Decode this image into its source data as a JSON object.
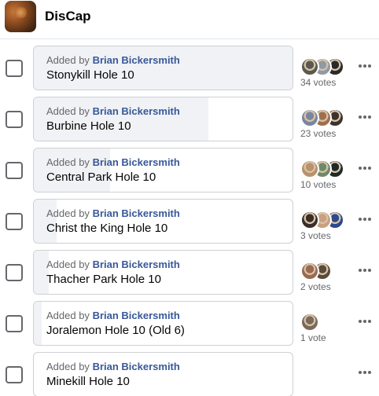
{
  "group": {
    "name": "DisCap"
  },
  "added_prefix": "Added by",
  "options": [
    {
      "author": "Brian Bickersmith",
      "name": "Stonykill Hole 10",
      "votes_label": "34 votes",
      "share": 1.0,
      "avatars": [
        "#5a5a4e",
        "#8f9aa3",
        "#2b2a28"
      ]
    },
    {
      "author": "Brian Bickersmith",
      "name": "Burbine Hole 10",
      "votes_label": "23 votes",
      "share": 0.676,
      "avatars": [
        "#7a86a0",
        "#a0704e",
        "#3b342e"
      ]
    },
    {
      "author": "Brian Bickersmith",
      "name": "Central Park Hole 10",
      "votes_label": "10 votes",
      "share": 0.294,
      "avatars": [
        "#b8926a",
        "#6d8a6a",
        "#1e2a26"
      ]
    },
    {
      "author": "Brian Bickersmith",
      "name": "Christ the King Hole 10",
      "votes_label": "3 votes",
      "share": 0.088,
      "avatars": [
        "#3a2e28",
        "#c9a080",
        "#2d4a8a"
      ]
    },
    {
      "author": "Brian Bickersmith",
      "name": "Thacher Park Hole 10",
      "votes_label": "2 votes",
      "share": 0.059,
      "avatars": [
        "#9a6a52",
        "#5a4a3a"
      ]
    },
    {
      "author": "Brian Bickersmith",
      "name": "Joralemon Hole 10 (Old 6)",
      "votes_label": "1 vote",
      "share": 0.029,
      "avatars": [
        "#7a6a5a"
      ]
    },
    {
      "author": "Brian Bickersmith",
      "name": "Minekill Hole 10",
      "votes_label": "",
      "share": 0.0,
      "avatars": []
    }
  ],
  "colors": {
    "accent_link": "#385898",
    "bar_fill": "#f0f2f5",
    "border": "#ced0d4",
    "muted": "#65676b"
  },
  "icons": {
    "checkbox": "checkbox-icon",
    "more": "more-options-icon",
    "avatar": "voter-avatar"
  }
}
